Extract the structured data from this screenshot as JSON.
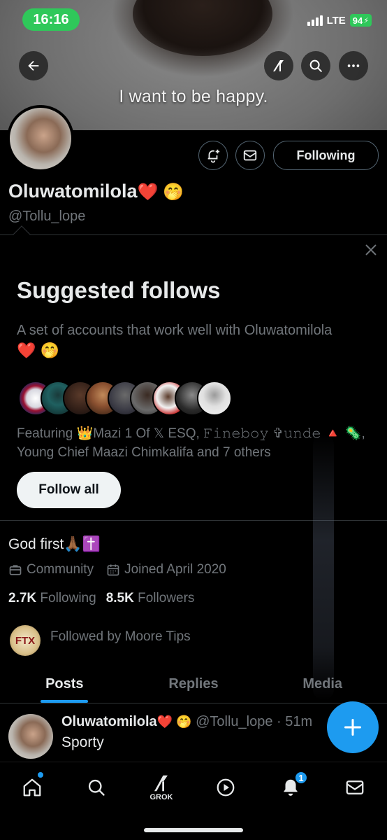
{
  "status_bar": {
    "time": "16:16",
    "network": "LTE",
    "battery": "94"
  },
  "banner": {
    "text": "I want to be happy."
  },
  "header_actions": {
    "back_icon": "arrow-left-icon",
    "grok_icon": "grok-icon",
    "search_icon": "search-icon",
    "more_icon": "more-horizontal-icon"
  },
  "profile": {
    "display_name": "Oluwatomilola",
    "name_emoji": "❤️ 🤭",
    "handle": "@Tollu_lope",
    "follow_button": "Following",
    "bio": "God first🙏🏾✝️",
    "category": "Community",
    "joined": "Joined April 2020",
    "following_count": "2.7K",
    "following_label": "Following",
    "followers_count": "8.5K",
    "followers_label": "Followers",
    "followed_by": "Followed by Moore Tips"
  },
  "suggested": {
    "title": "Suggested follows",
    "description": "A set of accounts that work well with Oluwatomilola",
    "description_emoji": "❤️ 🤭",
    "featuring": "Featuring 👑Mazi 1 Of 𝕏 ESQ, 𝙵𝚒𝚗𝚎𝚋𝚘𝚢 ✞𝚞𝚗𝚍𝚎 🔺 🦠, Young Chief Maazi Chimkalifa and 7 others",
    "follow_all": "Follow all"
  },
  "tabs": [
    {
      "label": "Posts",
      "active": true
    },
    {
      "label": "Replies",
      "active": false
    },
    {
      "label": "Media",
      "active": false
    }
  ],
  "post": {
    "name": "Oluwatomilola",
    "name_emoji": "❤️ 🤭",
    "handle_time": "@Tollu_lope · 51m",
    "text": "Sporty"
  },
  "bottom_nav": {
    "grok_label": "GROK",
    "notifications_badge": "1"
  },
  "colors": {
    "accent": "#1d9bf0",
    "background": "#000000",
    "secondary_text": "#71767b",
    "status_green": "#2fc85a"
  }
}
